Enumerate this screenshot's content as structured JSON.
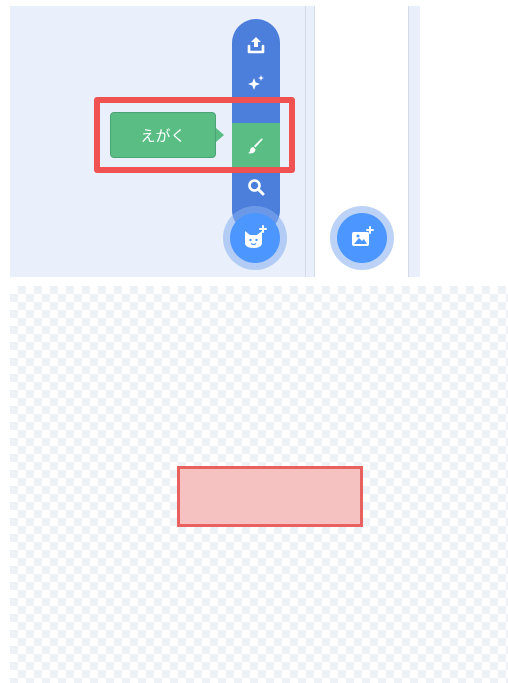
{
  "sprite_menu": {
    "items": [
      {
        "name": "upload",
        "icon": "upload-icon"
      },
      {
        "name": "surprise",
        "icon": "sparkles-icon"
      },
      {
        "name": "paint",
        "icon": "paintbrush-icon",
        "active": true
      },
      {
        "name": "search",
        "icon": "search-icon"
      }
    ],
    "main_button_icon": "cat-plus-icon"
  },
  "stage_menu": {
    "main_button_icon": "backdrop-plus-icon"
  },
  "tooltip": {
    "label": "えがく"
  },
  "canvas": {
    "shape": "rectangle",
    "fill_color": "#f6c1c1",
    "stroke_color": "#e8615f"
  },
  "colors": {
    "menu_blue": "#4c7fdb",
    "fab_blue": "#4c97ff",
    "active_green": "#59bd84",
    "highlight_red": "#f05151",
    "pane_bg": "#e9f0fb"
  }
}
